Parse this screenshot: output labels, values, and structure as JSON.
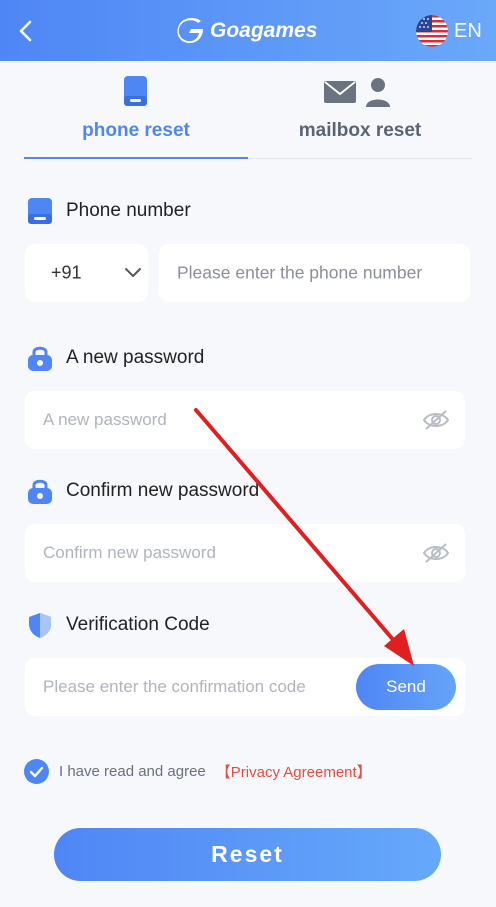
{
  "header": {
    "back_icon": "chevron-left-icon",
    "app_name": "Goagames",
    "language": "EN",
    "flag_icon": "us-flag-icon"
  },
  "tabs": [
    {
      "label": "phone reset",
      "icon": "phone-icon",
      "active": true
    },
    {
      "label": "mailbox reset",
      "icon": "mail-user-icon",
      "active": false
    }
  ],
  "phone": {
    "label": "Phone number",
    "country_code": "+91",
    "placeholder": "Please enter the phone number"
  },
  "new_password": {
    "label": "A new password",
    "placeholder": "A new password"
  },
  "confirm_password": {
    "label": "Confirm new password",
    "placeholder": "Confirm new password"
  },
  "verification": {
    "label": "Verification Code",
    "placeholder": "Please enter the confirmation code",
    "send_label": "Send"
  },
  "agreement": {
    "checked": true,
    "text": "I have read and agree",
    "link": "【Privacy Agreement】"
  },
  "reset_label": "Reset",
  "colors": {
    "primary": "#4f86f5",
    "link": "#e74c3c",
    "annotation_arrow": "#e02020"
  }
}
